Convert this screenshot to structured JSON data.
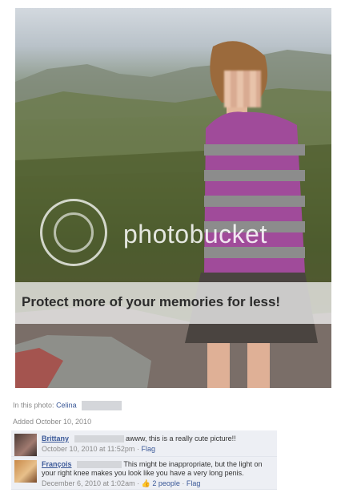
{
  "watermark": {
    "brand": "photobucket",
    "banner": "Protect more of your memories for less!"
  },
  "tag_line": {
    "prefix": "In this photo:",
    "person": "Celina"
  },
  "added": "Added October 10, 2010",
  "comments": [
    {
      "name": "Brittany",
      "text": "awww, this is a really cute picture!!",
      "time": "October 10, 2010 at 11:52pm",
      "sep": "·",
      "flag": "Flag"
    },
    {
      "name": "François",
      "text": "This might be inappropriate, but the light on your right knee makes you look like you have a very long penis.",
      "time": "December 6, 2010 at 1:02am",
      "sep": "·",
      "likes": "2 people",
      "flag": "Flag"
    }
  ],
  "colors": {
    "link": "#3b5998",
    "comment_bg": "#edeff4"
  }
}
